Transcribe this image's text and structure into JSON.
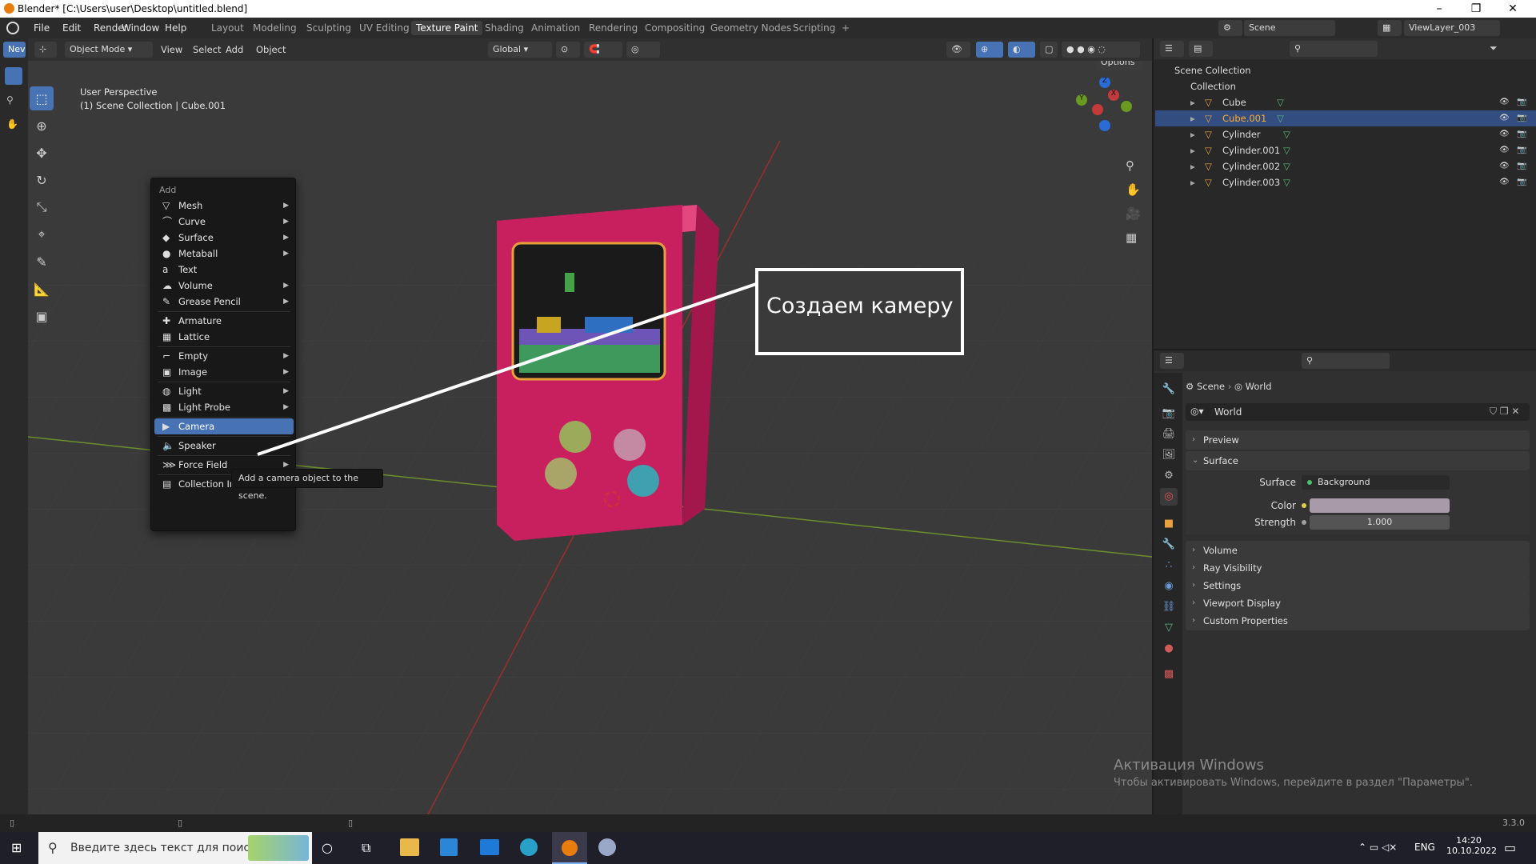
{
  "window": {
    "title": "Blender* [C:\\Users\\user\\Desktop\\untitled.blend]"
  },
  "menubar": {
    "menus": [
      "File",
      "Edit",
      "Render",
      "Window",
      "Help"
    ],
    "workspaces": [
      "Layout",
      "Modeling",
      "Sculpting",
      "UV Editing",
      "Texture Paint",
      "Shading",
      "Animation",
      "Rendering",
      "Compositing",
      "Geometry Nodes",
      "Scripting"
    ],
    "active_workspace": "Texture Paint",
    "add_workspace": "+",
    "scene": "Scene",
    "view_layer": "ViewLayer_003"
  },
  "viewport_header": {
    "mode": "Object Mode",
    "menus": [
      "View",
      "Select",
      "Add",
      "Object"
    ],
    "transform_orientation": "Global",
    "options": "Options"
  },
  "viewport": {
    "perspective_label": "User Perspective",
    "context_label": "(1) Scene Collection | Cube.001",
    "gizmo_axes": [
      "Z",
      "Y",
      "X"
    ]
  },
  "add_menu": {
    "title": "Add",
    "groups": [
      [
        {
          "label": "Mesh",
          "icon": "mesh-icon",
          "sub": true
        },
        {
          "label": "Curve",
          "icon": "curve-icon",
          "sub": true
        },
        {
          "label": "Surface",
          "icon": "surface-icon",
          "sub": true
        },
        {
          "label": "Metaball",
          "icon": "metaball-icon",
          "sub": true
        },
        {
          "label": "Text",
          "icon": "text-icon",
          "sub": false
        },
        {
          "label": "Volume",
          "icon": "volume-icon",
          "sub": true
        },
        {
          "label": "Grease Pencil",
          "icon": "grease-pencil-icon",
          "sub": true
        }
      ],
      [
        {
          "label": "Armature",
          "icon": "armature-icon",
          "sub": false
        },
        {
          "label": "Lattice",
          "icon": "lattice-icon",
          "sub": false
        }
      ],
      [
        {
          "label": "Empty",
          "icon": "empty-icon",
          "sub": true
        },
        {
          "label": "Image",
          "icon": "image-icon",
          "sub": true
        }
      ],
      [
        {
          "label": "Light",
          "icon": "light-icon",
          "sub": true
        },
        {
          "label": "Light Probe",
          "icon": "light-probe-icon",
          "sub": true
        }
      ],
      [
        {
          "label": "Camera",
          "icon": "camera-icon",
          "sub": false,
          "highlighted": true
        }
      ],
      [
        {
          "label": "Speaker",
          "icon": "speaker-icon",
          "sub": false
        }
      ],
      [
        {
          "label": "Force Field",
          "icon": "force-field-icon",
          "sub": true
        }
      ],
      [
        {
          "label": "Collection Instance",
          "icon": "collection-instance-icon",
          "sub": true
        }
      ]
    ],
    "tooltip": "Add a camera object to the scene."
  },
  "annotation": {
    "text": "Создаем камеру"
  },
  "outliner": {
    "root": "Scene Collection",
    "collection": "Collection",
    "items": [
      {
        "name": "Cube",
        "selected": false
      },
      {
        "name": "Cube.001",
        "selected": true
      },
      {
        "name": "Cylinder",
        "selected": false
      },
      {
        "name": "Cylinder.001",
        "selected": false
      },
      {
        "name": "Cylinder.002",
        "selected": false
      },
      {
        "name": "Cylinder.003",
        "selected": false
      }
    ]
  },
  "properties": {
    "breadcrumb": [
      "Scene",
      "World"
    ],
    "world_name": "World",
    "sections_top": [
      "Preview",
      "Surface"
    ],
    "surface_label": "Surface",
    "surface_value": "Background",
    "color_label": "Color",
    "color_value": "#a89aa8",
    "strength_label": "Strength",
    "strength_value": "1.000",
    "sections_bottom": [
      "Volume",
      "Ray Visibility",
      "Settings",
      "Viewport Display",
      "Custom Properties"
    ]
  },
  "statusbar": {
    "version": "3.3.0"
  },
  "watermark": {
    "line1": "Активация Windows",
    "line2": "Чтобы активировать Windows, перейдите в раздел \"Параметры\"."
  },
  "taskbar": {
    "search_placeholder": "Введите здесь текст для поиска",
    "lang": "ENG",
    "time": "14:20",
    "date": "10.10.2022"
  },
  "colors": {
    "accent": "#4772b3",
    "selection": "#334d80",
    "brand": "#e87d0d"
  }
}
